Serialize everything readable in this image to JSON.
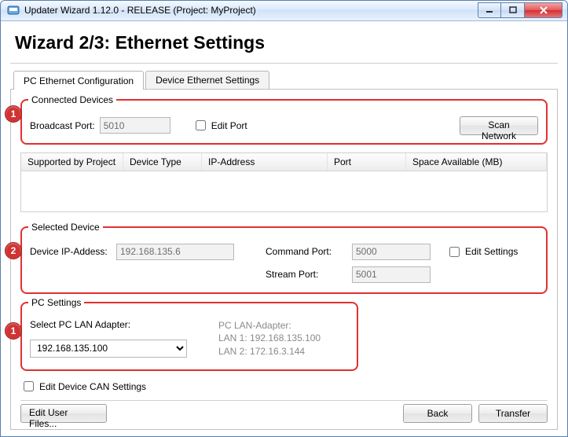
{
  "window": {
    "title": "Updater Wizard 1.12.0 - RELEASE (Project: MyProject)"
  },
  "page": {
    "heading": "Wizard 2/3:   Ethernet Settings"
  },
  "tabs": {
    "pc_config": "PC Ethernet Configuration",
    "device_settings": "Device Ethernet Settings"
  },
  "connected": {
    "legend": "Connected Devices",
    "broadcast_label": "Broadcast Port:",
    "broadcast_value": "5010",
    "edit_port_label": "Edit Port",
    "scan_label": "Scan Network",
    "columns": {
      "c1": "Supported by Project",
      "c2": "Device Type",
      "c3": "IP-Address",
      "c4": "Port",
      "c5": "Space Available (MB)"
    }
  },
  "selected": {
    "legend": "Selected Device",
    "ip_label": "Device IP-Addess:",
    "ip_value": "192.168.135.6",
    "cmd_label": "Command  Port:",
    "cmd_value": "5000",
    "stream_label": "Stream Port:",
    "stream_value": "5001",
    "edit_settings_label": "Edit Settings"
  },
  "pc": {
    "legend": "PC Settings",
    "adapter_label": "Select PC LAN Adapter:",
    "adapter_value": "192.168.135.100",
    "info_header": "PC LAN-Adapter:",
    "info_lan1": "LAN 1: 192.168.135.100",
    "info_lan2": "LAN 2: 172.16.3.144"
  },
  "bottom": {
    "edit_can_label": "Edit Device CAN Settings",
    "edit_user_files": "Edit User Files...",
    "back": "Back",
    "transfer": "Transfer"
  },
  "callouts": {
    "one": "1",
    "two": "2",
    "one_b": "1"
  }
}
